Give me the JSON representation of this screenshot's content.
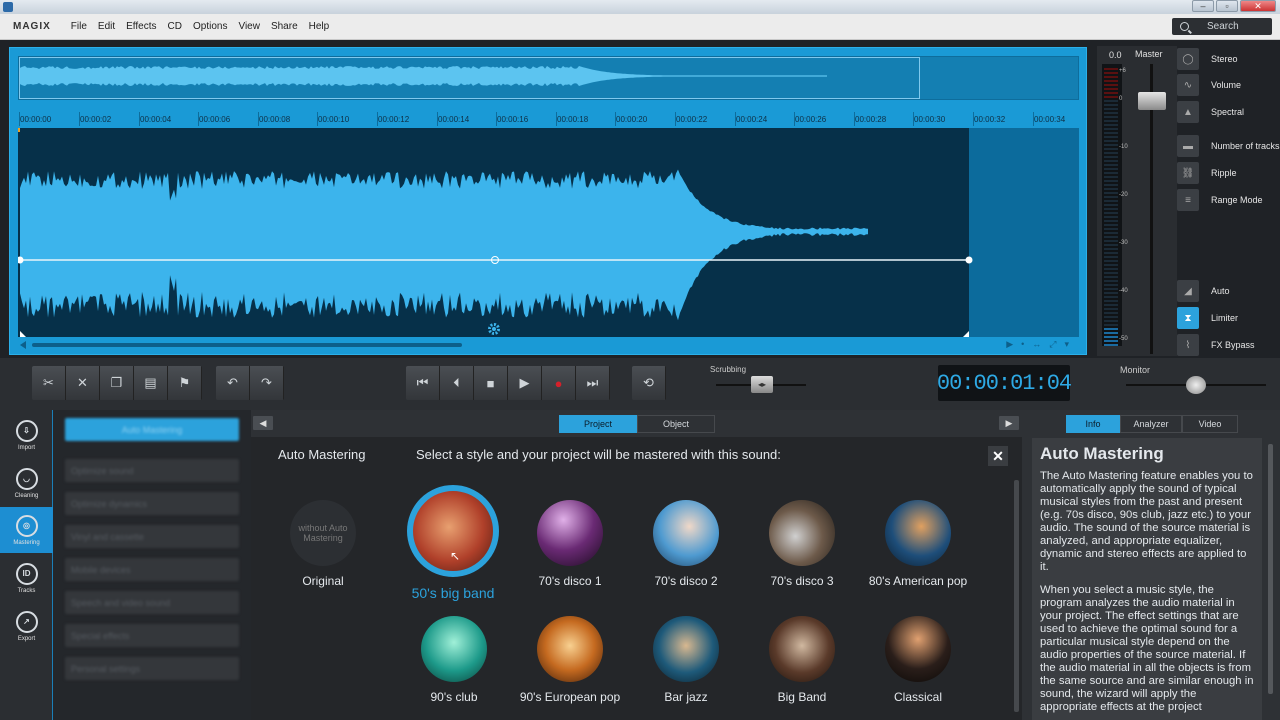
{
  "menubar": {
    "brand": "MAGIX",
    "items": [
      "File",
      "Edit",
      "Effects",
      "CD",
      "Options",
      "View",
      "Share",
      "Help"
    ],
    "search_label": "Search"
  },
  "ruler": {
    "ticks": [
      "00:00:00",
      "00:00:02",
      "00:00:04",
      "00:00:06",
      "00:00:08",
      "00:00:10",
      "00:00:12",
      "00:00:14",
      "00:00:16",
      "00:00:18",
      "00:00:20",
      "00:00:22",
      "00:00:24",
      "00:00:26",
      "00:00:28",
      "00:00:30",
      "00:00:32",
      "00:00:34"
    ]
  },
  "meter": {
    "value": "0.0",
    "master_label": "Master",
    "scale": [
      "+6",
      "0",
      "-10",
      "-20",
      "-30",
      "-40",
      "-50"
    ]
  },
  "side_panel": {
    "items": [
      {
        "label": "Stereo",
        "icon": "stereo-icon"
      },
      {
        "label": "Volume",
        "icon": "volume-icon"
      },
      {
        "label": "Spectral",
        "icon": "spectral-icon"
      },
      {
        "label": "Number of tracks",
        "icon": "tracks-count-icon"
      },
      {
        "label": "Ripple",
        "icon": "ripple-icon"
      },
      {
        "label": "Range Mode",
        "icon": "range-mode-icon"
      },
      {
        "label": "Auto",
        "icon": "auto-icon"
      },
      {
        "label": "Limiter",
        "icon": "limiter-icon"
      },
      {
        "label": "FX Bypass",
        "icon": "fx-bypass-icon"
      }
    ]
  },
  "transport": {
    "scrubbing_label": "Scrubbing",
    "timecode": "00:00:01:04",
    "monitor_label": "Monitor"
  },
  "left_nav": {
    "items": [
      {
        "label": "Import",
        "glyph": "⇩"
      },
      {
        "label": "Cleaning",
        "glyph": "◡"
      },
      {
        "label": "Mastering",
        "glyph": "◎"
      },
      {
        "label": "Tracks",
        "glyph": "ID"
      },
      {
        "label": "Export",
        "glyph": "↗"
      }
    ]
  },
  "style_list": {
    "active": "Auto Mastering",
    "items": [
      "Optimize sound",
      "Optimize dynamics",
      "Vinyl and cassette",
      "Mobile devices",
      "Speech and video sound",
      "Special effects",
      "Personal settings"
    ]
  },
  "center": {
    "tabs": [
      "Project",
      "Object"
    ],
    "title": "Auto Mastering",
    "description": "Select a style and your project will be mastered with this sound:",
    "close": "✕",
    "original_disc_text": "without Auto Mastering",
    "original_label": "Original",
    "styles": [
      {
        "label": "50's big band",
        "selected": true,
        "color": "#b0402a"
      },
      {
        "label": "70's disco 1",
        "selected": false,
        "color": "#6a2a74"
      },
      {
        "label": "70's disco 2",
        "selected": false,
        "color": "#4e9ad0"
      },
      {
        "label": "70's disco 3",
        "selected": false,
        "color": "#6d5a4a"
      },
      {
        "label": "80's American pop",
        "selected": false,
        "color": "#1e4e7a"
      },
      {
        "label": "90's club",
        "selected": false,
        "color": "#1d9a8a"
      },
      {
        "label": "90's European pop",
        "selected": false,
        "color": "#c56a20"
      },
      {
        "label": "Bar jazz",
        "selected": false,
        "color": "#1e5a7a"
      },
      {
        "label": "Big Band",
        "selected": false,
        "color": "#5a3a2a"
      },
      {
        "label": "Classical",
        "selected": false,
        "color": "#2a1e1a"
      }
    ]
  },
  "right_panel": {
    "tabs": [
      "Info",
      "Analyzer",
      "Video"
    ],
    "title": "Auto Mastering",
    "paragraphs": [
      "The Auto Mastering feature enables you to automatically apply the sound of typical musical styles from the past and present (e.g. 70s disco, 90s club, jazz etc.) to your audio. The sound of the source material is analyzed, and appropriate equalizer, dynamic and stereo effects are applied to it.",
      "When you select a music style, the program analyzes the audio material in your project. The effect settings that are used to achieve the optimal sound for a particular musical style depend on the audio properties of the source material. If the audio material in all the objects is from the same source and are similar enough in sound, the wizard will apply the appropriate effects at the project"
    ]
  },
  "colors": {
    "accent": "#2ca2dc",
    "waveform": "#3cb4ec",
    "timecode": "#2ea9e4"
  }
}
